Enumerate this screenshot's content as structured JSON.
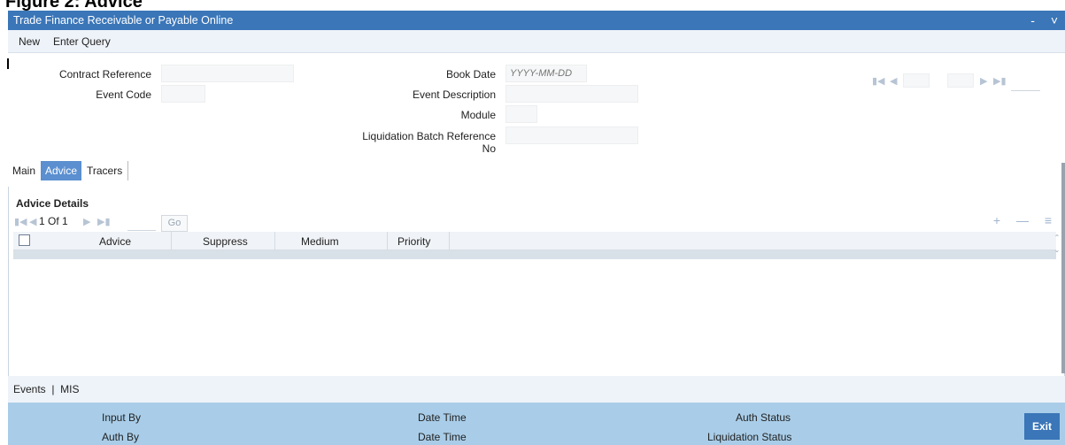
{
  "figure_caption": "Figure 2: Advice",
  "window": {
    "title": "Trade Finance Receivable or Payable Online",
    "minimize_label": "-",
    "close_label": "˅"
  },
  "menu": {
    "new_label": "New",
    "enter_query_label": "Enter Query"
  },
  "form": {
    "contract_reference_label": "Contract Reference",
    "event_code_label": "Event Code",
    "book_date_label": "Book Date",
    "book_date_placeholder": "YYYY-MM-DD",
    "event_description_label": "Event Description",
    "module_label": "Module",
    "liquidation_batch_label_line1": "Liquidation Batch Reference",
    "liquidation_batch_label_line2": "No"
  },
  "tabs": {
    "main": "Main",
    "advice": "Advice",
    "tracers": "Tracers"
  },
  "advice_details": {
    "title": "Advice Details",
    "pager_text": "1 Of 1",
    "go_label": "Go",
    "columns": [
      "Advice",
      "Suppress",
      "Medium",
      "Priority"
    ]
  },
  "bottom_links": {
    "events": "Events",
    "separator": "|",
    "mis": "MIS"
  },
  "footer": {
    "input_by": "Input By",
    "auth_by": "Auth By",
    "date_time_1": "Date Time",
    "date_time_2": "Date Time",
    "auth_status": "Auth Status",
    "liquidation_status": "Liquidation Status",
    "exit_label": "Exit"
  },
  "colors": {
    "titlebar": "#3a76b8",
    "active_tab": "#5b8fd0",
    "footer": "#a9cde8"
  },
  "icons": [
    "first-page-icon",
    "prev-page-icon",
    "next-page-icon",
    "last-page-icon",
    "add-row-icon",
    "delete-row-icon",
    "grid-view-icon",
    "scroll-up-icon",
    "scroll-down-icon"
  ]
}
